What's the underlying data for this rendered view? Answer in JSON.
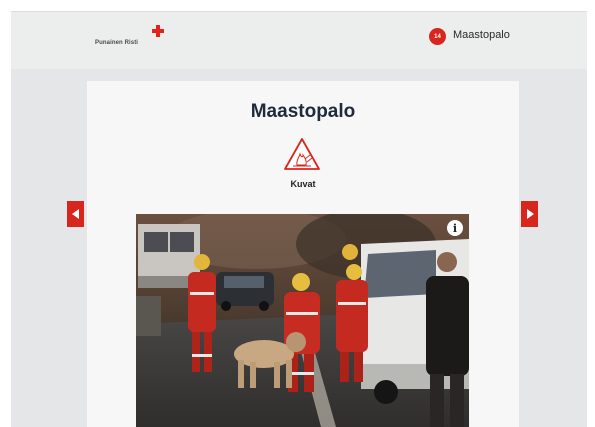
{
  "header": {
    "logo_text": "Punainen Risti",
    "count_badge": "14",
    "title": "Maastopalo"
  },
  "card": {
    "title": "Maastopalo",
    "section_label": "Kuvat",
    "hazard_icon": "fire-warning-icon"
  },
  "navigation": {
    "prev_icon": "chevron-left-icon",
    "next_icon": "chevron-right-icon"
  },
  "photo": {
    "info_icon": "info-icon",
    "info_glyph": "i"
  },
  "colors": {
    "brand_red": "#d7261d",
    "title_navy": "#1f2a3a",
    "background": "#e5e6e8"
  }
}
